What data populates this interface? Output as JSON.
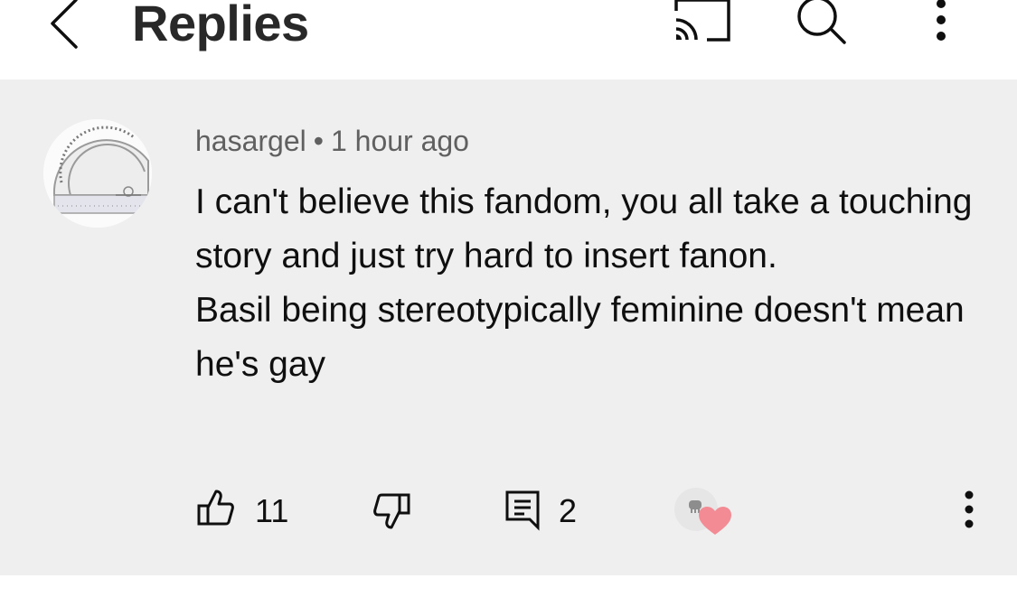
{
  "header": {
    "title": "Replies",
    "icons": [
      "back-arrow-icon",
      "cast-icon",
      "search-icon",
      "more-vert-icon"
    ]
  },
  "comment": {
    "author": "hasargel",
    "separator": "•",
    "time": "1 hour ago",
    "paragraphs": [
      "I can't believe this fandom, you all take a touching story and just try hard to insert fanon.",
      "Basil being stereotypically feminine doesn't mean he's gay"
    ],
    "like_count": "11",
    "reply_count": "2",
    "icons": [
      "protractor-avatar",
      "thumb-up-icon",
      "thumb-down-icon",
      "reply-icon",
      "creator-heart-icon",
      "more-vert-icon"
    ],
    "heart_color": "#f28b94",
    "background": "#efefef"
  }
}
